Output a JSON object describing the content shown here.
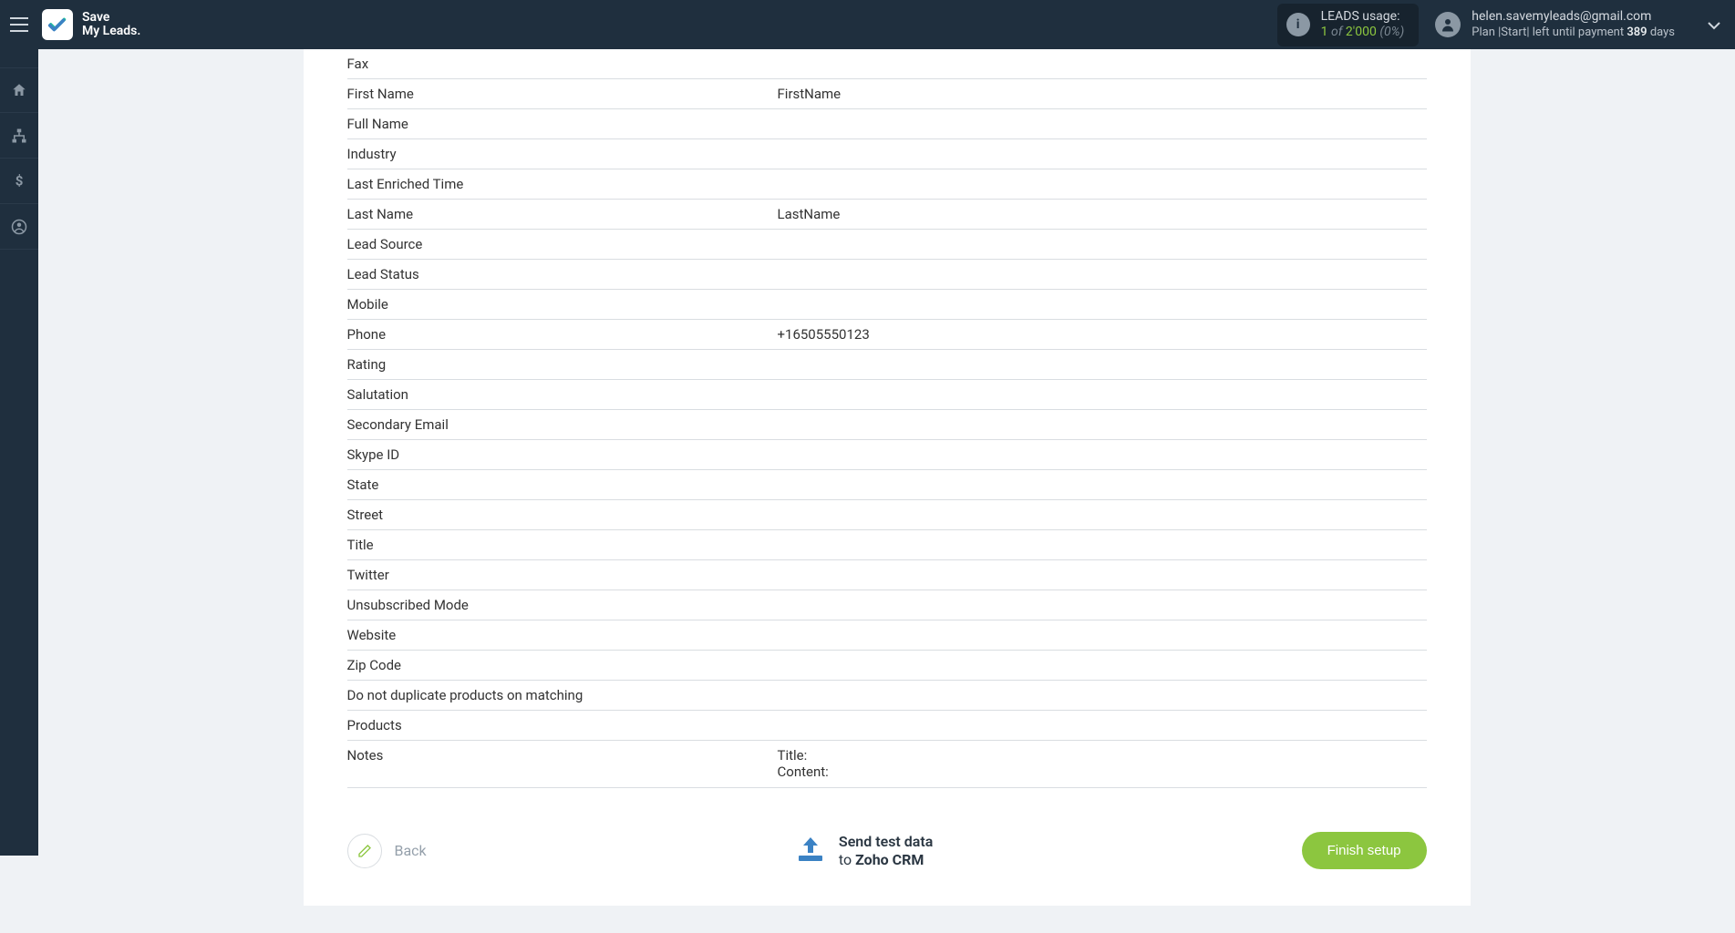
{
  "brand": {
    "line1": "Save",
    "line2": "My Leads."
  },
  "usage": {
    "label": "LEADS usage:",
    "current": "1",
    "of": "of",
    "total": "2'000",
    "percent": "(0%)"
  },
  "user": {
    "email": "helen.savemyleads@gmail.com",
    "plan_prefix": "Plan |Start| left until payment",
    "days_num": "389",
    "days_label": "days"
  },
  "fields": [
    {
      "label": "Fax",
      "value": ""
    },
    {
      "label": "First Name",
      "value": "FirstName"
    },
    {
      "label": "Full Name",
      "value": ""
    },
    {
      "label": "Industry",
      "value": ""
    },
    {
      "label": "Last Enriched Time",
      "value": ""
    },
    {
      "label": "Last Name",
      "value": "LastName"
    },
    {
      "label": "Lead Source",
      "value": ""
    },
    {
      "label": "Lead Status",
      "value": ""
    },
    {
      "label": "Mobile",
      "value": ""
    },
    {
      "label": "Phone",
      "value": "+16505550123"
    },
    {
      "label": "Rating",
      "value": ""
    },
    {
      "label": "Salutation",
      "value": ""
    },
    {
      "label": "Secondary Email",
      "value": ""
    },
    {
      "label": "Skype ID",
      "value": ""
    },
    {
      "label": "State",
      "value": ""
    },
    {
      "label": "Street",
      "value": ""
    },
    {
      "label": "Title",
      "value": ""
    },
    {
      "label": "Twitter",
      "value": ""
    },
    {
      "label": "Unsubscribed Mode",
      "value": ""
    },
    {
      "label": "Website",
      "value": ""
    },
    {
      "label": "Zip Code",
      "value": ""
    },
    {
      "label": "Do not duplicate products on matching",
      "value": ""
    },
    {
      "label": "Products",
      "value": ""
    }
  ],
  "notes": {
    "label": "Notes",
    "value": "Title:\nContent:"
  },
  "actions": {
    "back": "Back",
    "send_line1": "Send test data",
    "send_to": "to",
    "send_dest": "Zoho CRM",
    "finish": "Finish setup"
  }
}
